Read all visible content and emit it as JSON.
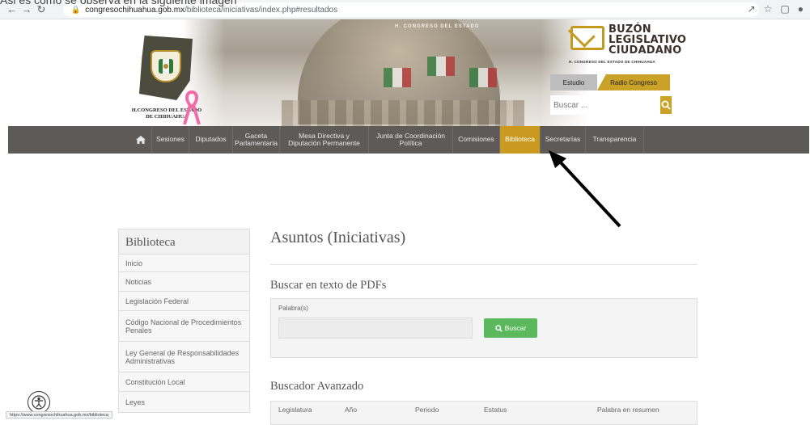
{
  "browser": {
    "url_host": "congresochihuahua.gob.mx",
    "url_path": "/biblioteca/iniciativas/index.php#resultados",
    "top_cropped_text": "Asi es como se observa en la siguiente imagen"
  },
  "header": {
    "logo_text_line1": "H.CONGRESO DEL ESTADO",
    "logo_text_line2": "DE CHIHUAHUA",
    "banner_text": "H. CONGRESO DEL ESTADO",
    "buzon_title_line1": "BUZÓN",
    "buzon_title_line2": "LEGISLATIVO",
    "buzon_title_line3": "CIUDADANO",
    "buzon_subtitle": "H. CONGRESO DEL ESTADO DE CHIHUAHUA",
    "radio_wave_label": "Estudio",
    "radio_label": "Radio Congreso",
    "search_placeholder": "Buscar ..."
  },
  "nav": {
    "items": [
      {
        "label": "Sesiones"
      },
      {
        "label": "Diputados"
      },
      {
        "label": "Gaceta Parlamentaria"
      },
      {
        "label": "Mesa Directiva y Diputación Permanente"
      },
      {
        "label": "Junta de Coordinación Política"
      },
      {
        "label": "Comisiones"
      },
      {
        "label": "Biblioteca"
      },
      {
        "label": "Secretarías"
      },
      {
        "label": "Transparencia"
      }
    ],
    "active": "Biblioteca"
  },
  "sidebar": {
    "title": "Biblioteca",
    "items": [
      {
        "label": "Inicio"
      },
      {
        "label": "Noticias"
      },
      {
        "label": "Legislación Federal"
      },
      {
        "label": "Código Nacional de Procedimientos Penales"
      },
      {
        "label": "Ley General de Responsabilidades Administrativas"
      },
      {
        "label": "Constitución Local"
      },
      {
        "label": "Leyes"
      }
    ]
  },
  "main": {
    "title": "Asuntos (Iniciativas)",
    "pdf_search": {
      "heading": "Buscar en texto de PDFs",
      "label": "Palabra(s)",
      "value": "",
      "button_label": "Buscar"
    },
    "advanced": {
      "heading": "Buscador Avanzado",
      "columns": [
        "Legislatura",
        "Año",
        "Periodo",
        "Estatus",
        "Palabra en resumen"
      ]
    }
  },
  "status_bar": {
    "hover_url": "https://www.congresochihuahua.gob.mx/biblioteca"
  },
  "colors": {
    "nav_bg": "#5e5a58",
    "accent_gold": "#c99a1f",
    "button_green": "#5cb85c"
  }
}
